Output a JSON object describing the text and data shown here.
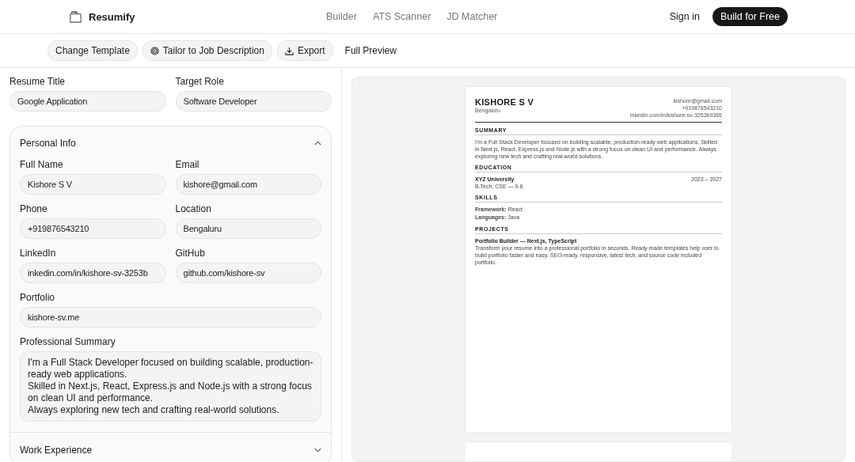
{
  "header": {
    "brand": "Resumify",
    "nav": [
      "Builder",
      "ATS Scanner",
      "JD Matcher"
    ],
    "sign_in": "Sign in",
    "cta": "Build for Free"
  },
  "toolbar": [
    {
      "label": "Change Template",
      "kind": "plain"
    },
    {
      "label": "Tailor to Job Description",
      "kind": "target"
    },
    {
      "label": "Export",
      "kind": "download"
    },
    {
      "label": "Full Preview",
      "kind": "link"
    }
  ],
  "resume_title": {
    "label": "Resume Title",
    "value": "Google Application"
  },
  "target_role": {
    "label": "Target Role",
    "value": "Software Developer"
  },
  "sections": [
    {
      "title": "Personal Info",
      "expanded": true,
      "fields": [
        {
          "label": "Full Name",
          "value": "Kishore S V",
          "kind": "input"
        },
        {
          "label": "Email",
          "value": "kishore@gmail.com",
          "kind": "input"
        },
        {
          "label": "Phone",
          "value": "+919876543210",
          "kind": "input"
        },
        {
          "label": "Location",
          "value": "Bengaluru",
          "kind": "input"
        },
        {
          "label": "LinkedIn",
          "value": "inkedin.com/in/kishore-sv-3253b",
          "kind": "input"
        },
        {
          "label": "GitHub",
          "value": "github.com/kishore-sv",
          "kind": "input"
        },
        {
          "label": "Portfolio",
          "value": "kishore-sv.me",
          "kind": "wide"
        },
        {
          "label": "Professional Summary",
          "value": "I'm a Full Stack Developer focused on building scalable, production-ready web applications.\nSkilled in Next.js, React, Express.js and Node.js with a strong focus on clean UI and performance.\nAlways exploring new tech and crafting real-world solutions.",
          "kind": "textarea"
        }
      ]
    },
    {
      "title": "Work Experience",
      "expanded": false
    }
  ],
  "preview": {
    "name": "KISHORE S V",
    "location": "Bengaluru",
    "contacts": [
      "kishore@gmail.com",
      "+919876543210",
      "inkedin.com/in/kishore-sv-3253b9365"
    ],
    "sections": [
      {
        "heading": "SUMMARY",
        "kind": "text",
        "text": "I'm a Full Stack Developer focused on building scalable, production-ready web applications. Skilled in Next.js, React, Express.js and Node.js with a strong focus on clean UI and performance. Always exploring new tech and crafting real-world solutions."
      },
      {
        "heading": "EDUCATION",
        "kind": "education",
        "school": "XYZ University",
        "dates": "2023 – 2027",
        "degree": "B.Tech, CSE — 9.6"
      },
      {
        "heading": "SKILLS",
        "kind": "skills",
        "lines": [
          "**Framework:** React",
          "**Languages:** Java"
        ]
      },
      {
        "heading": "PROJECTS",
        "kind": "project",
        "title": "Portfolio Builder — Next.js, TypeScript",
        "text": "Transform your resume into a professional portfolio in seconds. Ready made templates help user to build portfolio faster and easy. SEO-ready, responsive, latest tech, and source code included portfolio."
      }
    ]
  }
}
